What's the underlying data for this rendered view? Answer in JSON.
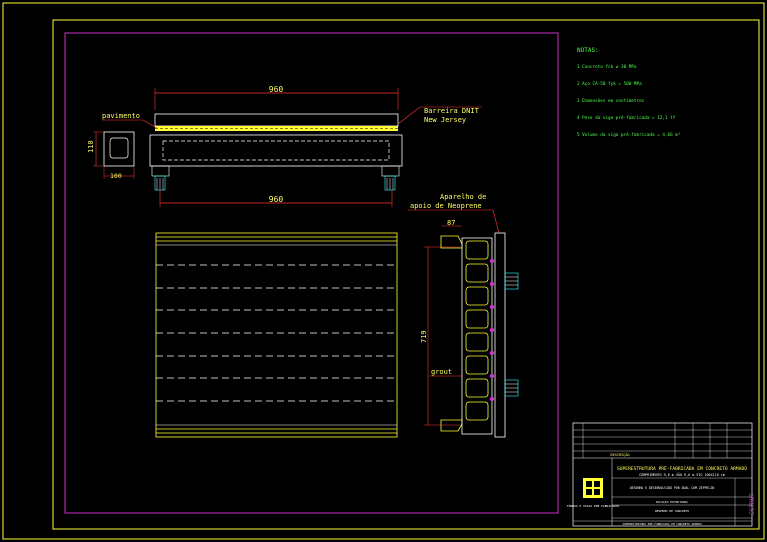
{
  "colors": {
    "background": "#000000",
    "frame": "#ffff33",
    "sheet_border": "#cc33cc",
    "dimension": "#ff3333",
    "label_text": "#ffff66",
    "notes_text": "#4dff4d",
    "geometry_white": "#ffffff",
    "cyan": "#33ffff"
  },
  "labels": {
    "top_width": "960",
    "bottom_width": "960",
    "pavimento": "pavimento",
    "barrier_line1": "Barreira DNIT",
    "barrier_line2": "New Jersey",
    "section_height": "110",
    "section_width": "100",
    "neoprene_line1": "Aparelho de",
    "neoprene_line2": "apoio de Neoprene",
    "spacing": "87",
    "total_length": "719",
    "grout": "grout"
  },
  "notes": {
    "title": "NOTAS:",
    "items": [
      "1 Concreto fck ≥ 30 MPa",
      "2 Aço CA-50 fyk = 500 MPa",
      "3 Dimensões em centímetros",
      "4 Peso da viga pré-fabricada = 12,1 tf",
      "5 Volume da viga pré-fabricada = 4,66 m³"
    ]
  },
  "title_block": {
    "revision_header": "DESCRIÇÃO",
    "project_title": "SUPERESTRUTURA PRÉ-FABRICADA EM CONCRETO ARMADO",
    "project_subtitle": "COMPRIMENTO 9,6 m  VÃO 9,6 m  VIG 100X110 cm",
    "drawing_line": "DESENHO E DESENVOLVIDO POR DUAL COM ZEPPELIN",
    "company_line1": "SOLUÇÃO ESTRUTURAL",
    "company_line2": "DESENHO DE CONCRETO",
    "footer_text": "SUPERESTRUTURA PRÉ-FABRICADA EM CONCRETO ARMADO",
    "logo_caption": "FÔRMAS E VIGAS PRÉ-FABRICADAS",
    "stamp": "ESTRUT"
  }
}
